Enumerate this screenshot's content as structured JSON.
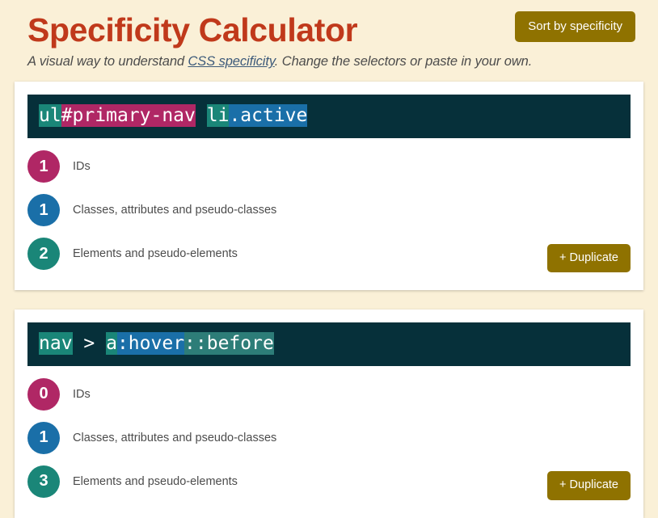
{
  "header": {
    "title": "Specificity Calculator",
    "subtitle_before": "A visual way to understand ",
    "subtitle_link": "CSS specificity",
    "subtitle_after": ". Change the selectors or paste in your own.",
    "sort_button_label": "Sort by specificity"
  },
  "colors": {
    "page_background": "#faf0d7",
    "card_background": "#ffffff",
    "title": "#c0391b",
    "button": "#8f7200",
    "code_background": "#06303a",
    "ids": "#b02765",
    "classes": "#1a6fa8",
    "elements": "#1a8678",
    "pseudo_elements": "#2d7d78",
    "link": "#3d5a7a"
  },
  "labels": {
    "ids": "IDs",
    "classes": "Classes, attributes and pseudo-classes",
    "elements": "Elements and pseudo-elements",
    "duplicate": "+ Duplicate"
  },
  "cards": [
    {
      "selector_text": "ul#primary-nav li.active",
      "tokens": [
        {
          "text": "ul",
          "kind": "element"
        },
        {
          "text": "#primary-nav",
          "kind": "id"
        },
        {
          "text": " ",
          "kind": "plain"
        },
        {
          "text": "li",
          "kind": "element"
        },
        {
          "text": ".active",
          "kind": "class"
        }
      ],
      "scores": {
        "ids": "1",
        "classes": "1",
        "elements": "2"
      }
    },
    {
      "selector_text": "nav > a:hover::before",
      "tokens": [
        {
          "text": "nav",
          "kind": "element"
        },
        {
          "text": " > ",
          "kind": "plain"
        },
        {
          "text": "a",
          "kind": "element"
        },
        {
          "text": ":hover",
          "kind": "class"
        },
        {
          "text": "::before",
          "kind": "pseudoel"
        }
      ],
      "scores": {
        "ids": "0",
        "classes": "1",
        "elements": "3"
      }
    }
  ]
}
